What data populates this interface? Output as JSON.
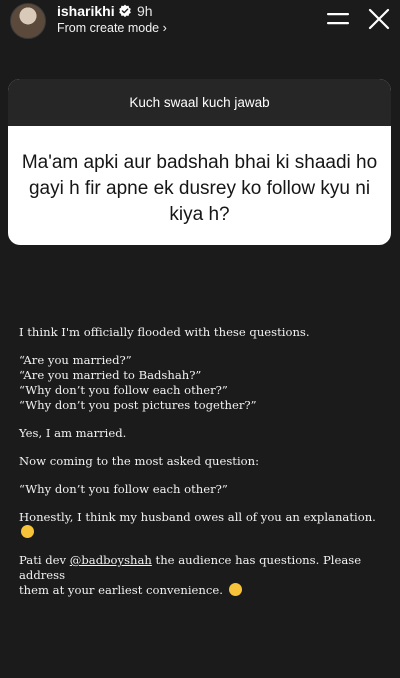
{
  "header": {
    "username": "isharikhi",
    "time": "9h",
    "source": "From create mode ›"
  },
  "question_box": {
    "title": "Kuch swaal kuch jawab",
    "question": "Ma'am apki aur badshah bhai ki shaadi ho gayi h fir apne ek dusrey ko follow kyu ni kiya h?"
  },
  "answer": {
    "intro": "I think I'm officially flooded with these questions.",
    "questions_list": [
      "“Are you married?”",
      "“Are you married to Badshah?”",
      "“Why don’t you follow each other?”",
      "“Why don’t you post pictures together?”"
    ],
    "married": "Yes, I am married.",
    "coming": "Now coming to the most asked question:",
    "quoted": "“Why don’t you follow each other?”",
    "honestly": "Honestly, I think my husband owes all of you an explanation.",
    "pati_prefix": "Pati dev ",
    "mention": "@badboyshah",
    "pati_suffix": " the audience has questions. Please address",
    "pati_line2": "them at your earliest convenience."
  },
  "icons": {
    "verified": "verified-badge-icon",
    "menu": "menu-icon",
    "close": "close-icon",
    "emoji_smile": "grinning-face-emoji",
    "emoji_laugh": "rolling-laughing-emoji"
  },
  "colors": {
    "background": "#1b1b1b",
    "question_header": "#262626",
    "question_body": "#ffffff"
  }
}
